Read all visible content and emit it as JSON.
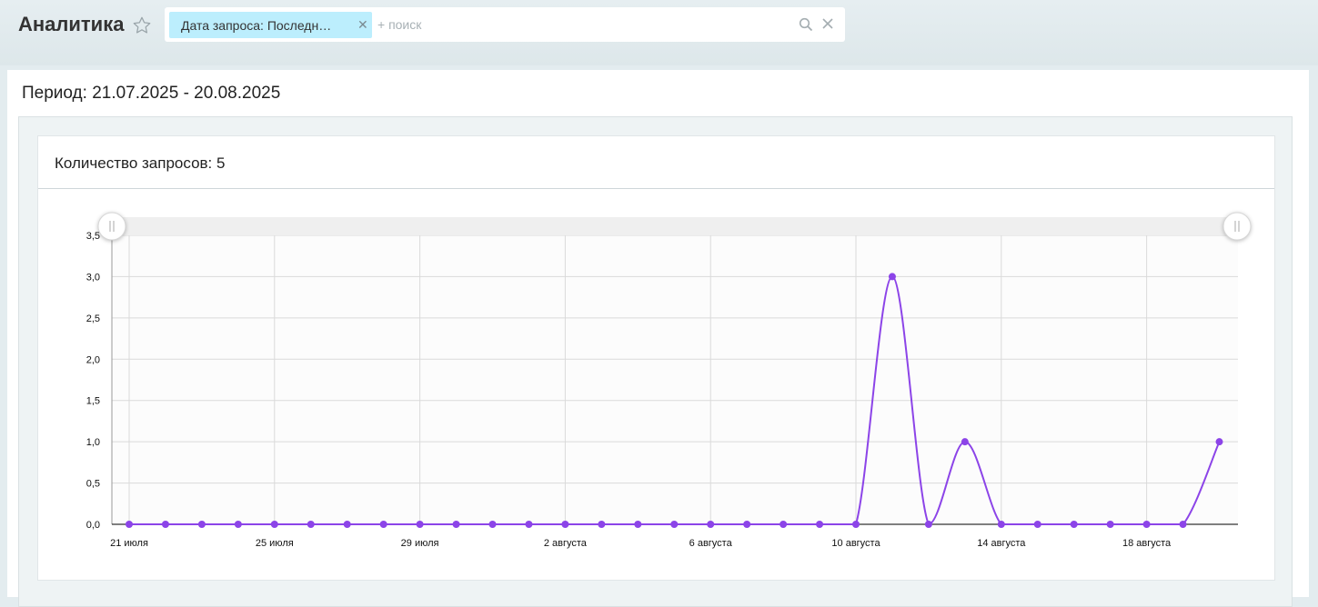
{
  "header": {
    "title": "Аналитика",
    "favorite_icon": "star-outline-icon"
  },
  "filter": {
    "tag_label": "Дата запроса: Последн…",
    "tag_remove_icon": "close-icon",
    "placeholder": "+ поиск",
    "search_icon": "search-icon",
    "clear_icon": "close-icon"
  },
  "report": {
    "period": "Период: 21.07.2025 - 20.08.2025",
    "count_label": "Количество запросов: 5"
  },
  "colors": {
    "series": "#8c44e8",
    "filter_tag_bg": "#bceefd",
    "page_bg": "#e3ecef"
  },
  "chart_data": {
    "type": "line",
    "title": "",
    "xlabel": "",
    "ylabel": "",
    "ylim": [
      0,
      3.5
    ],
    "yticks": [
      "0,0",
      "0,5",
      "1,0",
      "1,5",
      "2,0",
      "2,5",
      "3,0",
      "3,5"
    ],
    "x": [
      "2025-07-21",
      "2025-07-22",
      "2025-07-23",
      "2025-07-24",
      "2025-07-25",
      "2025-07-26",
      "2025-07-27",
      "2025-07-28",
      "2025-07-29",
      "2025-07-30",
      "2025-07-31",
      "2025-08-01",
      "2025-08-02",
      "2025-08-03",
      "2025-08-04",
      "2025-08-05",
      "2025-08-06",
      "2025-08-07",
      "2025-08-08",
      "2025-08-09",
      "2025-08-10",
      "2025-08-11",
      "2025-08-12",
      "2025-08-13",
      "2025-08-14",
      "2025-08-15",
      "2025-08-16",
      "2025-08-17",
      "2025-08-18",
      "2025-08-19",
      "2025-08-20"
    ],
    "xtick_labels": [
      "21 июля",
      "25 июля",
      "29 июля",
      "2 августа",
      "6 августа",
      "10 августа",
      "14 августа",
      "18 августа"
    ],
    "series": [
      {
        "values": [
          0,
          0,
          0,
          0,
          0,
          0,
          0,
          0,
          0,
          0,
          0,
          0,
          0,
          0,
          0,
          0,
          0,
          0,
          0,
          0,
          0,
          3,
          0,
          1,
          0,
          0,
          0,
          0,
          0,
          0,
          1
        ]
      }
    ],
    "grid": true,
    "range_slider": true
  }
}
